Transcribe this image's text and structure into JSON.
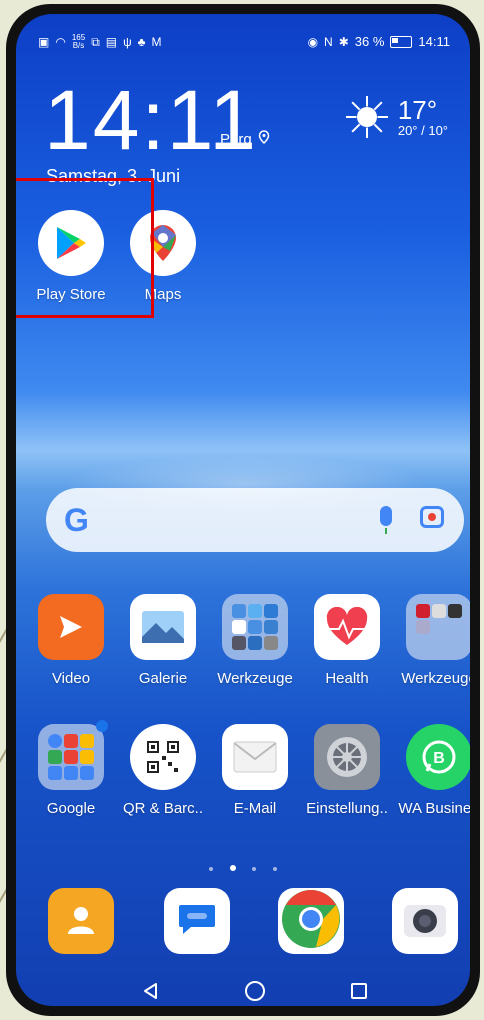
{
  "status_bar": {
    "net_speed_value": "165",
    "net_speed_unit": "B/s",
    "battery": "36 %",
    "time": "14:11"
  },
  "lock_widget": {
    "clock": "14:11",
    "city": "Perg",
    "date": "Samstag, 3. Juni",
    "temperature": "17°",
    "range": "20° / 10°"
  },
  "top_apps": [
    {
      "label": "Play Store"
    },
    {
      "label": "Maps"
    }
  ],
  "grid_row1": [
    {
      "label": "Video"
    },
    {
      "label": "Galerie"
    },
    {
      "label": "Werkzeuge"
    },
    {
      "label": "Health"
    },
    {
      "label": "Werkzeuge"
    }
  ],
  "grid_row2": [
    {
      "label": "Google"
    },
    {
      "label": "QR & Barc.."
    },
    {
      "label": "E-Mail"
    },
    {
      "label": "Einstellung.."
    },
    {
      "label": "WA Busine.."
    }
  ],
  "colors": {
    "highlight": "#e00000",
    "video": "#f26b21",
    "contacts": "#f5a623",
    "whatsapp": "#25d366"
  }
}
